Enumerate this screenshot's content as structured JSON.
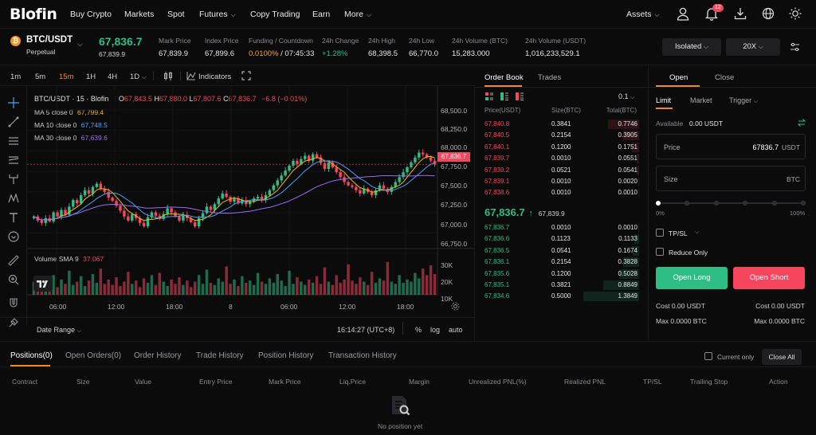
{
  "brand": {
    "logo": "Blofin"
  },
  "nav": {
    "items": [
      "Buy Crypto",
      "Markets",
      "Spot",
      "Futures",
      "Copy Trading",
      "Earn",
      "More"
    ],
    "assets": "Assets",
    "notification_count": "12"
  },
  "ticker": {
    "symbol": "BTC/USDT",
    "type": "Perpetual",
    "price": "67,836.7",
    "price_sub": "67,839.9",
    "stats": [
      {
        "label": "Mark Price",
        "value": "67,839.9"
      },
      {
        "label": "Index Price",
        "value": "67,899.6"
      },
      {
        "label": "Funding / Countdown",
        "value_a": "0.0100%",
        "value_b": " / 07:45:33"
      },
      {
        "label": "24h Change",
        "value": "+1.28%"
      },
      {
        "label": "24h High",
        "value": "68,398.5"
      },
      {
        "label": "24h Low",
        "value": "66,770.0"
      },
      {
        "label": "24h Volume (BTC)",
        "value": "15,283.000"
      },
      {
        "label": "24h Volume (USDT)",
        "value": "1,016,233,529.1"
      }
    ],
    "margin_mode": "Isolated",
    "leverage": "20X"
  },
  "toolbar": {
    "timeframes": [
      "1m",
      "5m",
      "15m",
      "1H",
      "4H",
      "1D"
    ],
    "active_tf": "15m",
    "indicators": "Indicators"
  },
  "chart": {
    "legend_title": "BTC/USDT · 15 · Blofin",
    "ohlc": {
      "o_label": "O",
      "o": "67,843.5",
      "h_label": "H",
      "h": "67,880.0",
      "l_label": "L",
      "l": "67,807.6",
      "c_label": "C",
      "c": "67,836.7",
      "chg": "−6.8 (−0.01%)"
    },
    "ma": [
      {
        "label": "MA 5 close 0",
        "value": "67,799.4",
        "color": "#f0b90b"
      },
      {
        "label": "MA 10 close 0",
        "value": "67,748.5",
        "color": "#4a9ff5"
      },
      {
        "label": "MA 30 close 0",
        "value": "67,639.6",
        "color": "#9b6cf0"
      }
    ],
    "volume_label": "Volume SMA 9",
    "volume_value": "37.067",
    "price_axis": [
      "68,500.0",
      "68,250.0",
      "68,000.0",
      "67,750.0",
      "67,500.0",
      "67,250.0",
      "67,000.0",
      "66,750.0"
    ],
    "current_price_tag": "67,836.7",
    "volume_axis": [
      "30K",
      "20K",
      "10K"
    ],
    "time_axis": [
      "06:00",
      "12:00",
      "18:00",
      "8",
      "06:00",
      "12:00",
      "18:00"
    ],
    "date_range": "Date Range",
    "clock": "16:14:27 (UTC+8)",
    "pct": "%",
    "log": "log",
    "auto": "auto",
    "up_color": "#2ebd85",
    "down_color": "#f6465d"
  },
  "chart_data": {
    "type": "candlestick",
    "title": "BTC/USDT · 15 · Blofin",
    "ylim": [
      66750,
      68500
    ],
    "ylabel": "USDT",
    "x_ticks": [
      "06:00",
      "12:00",
      "18:00",
      "8",
      "06:00",
      "12:00",
      "18:00"
    ],
    "close": [
      67200,
      67150,
      67120,
      67180,
      67140,
      67250,
      67200,
      67280,
      67220,
      67320,
      67400,
      67360,
      67460,
      67520,
      67480,
      67560,
      67600,
      67540,
      67500,
      67430,
      67390,
      67330,
      67270,
      67200,
      67150,
      67230,
      67180,
      67120,
      67080,
      67190,
      67250,
      67210,
      67170,
      67230,
      67300,
      67250,
      67200,
      67150,
      67220,
      67180,
      67130,
      67080,
      67180,
      67240,
      67320,
      67280,
      67350,
      67420,
      67480,
      67440,
      67380,
      67420,
      67360,
      67400,
      67350,
      67380,
      67420,
      67440,
      67400,
      67460,
      67520,
      67580,
      67640,
      67700,
      67760,
      67820,
      67880,
      67840,
      67900,
      67940,
      67880,
      67960,
      67920,
      67850,
      67780,
      67860,
      67800,
      67740,
      67680,
      67620,
      67580,
      67560,
      67520,
      67480,
      67540,
      67500,
      67460,
      67520,
      67580,
      67540,
      67500,
      67560,
      67620,
      67680,
      67740,
      67800,
      67860,
      67920,
      67980,
      67960,
      67920,
      67880,
      67836.7
    ],
    "volume": [
      12,
      8,
      15,
      9,
      11,
      18,
      7,
      14,
      10,
      22,
      9,
      12,
      17,
      8,
      13,
      19,
      11,
      24,
      10,
      14,
      9,
      16,
      8,
      12,
      21,
      10,
      13,
      7,
      15,
      11,
      18,
      9,
      20,
      12,
      8,
      14,
      10,
      16,
      9,
      13,
      7,
      12,
      18,
      10,
      23,
      11,
      9,
      15,
      12,
      26,
      10,
      14,
      8,
      17,
      11,
      13,
      9,
      20,
      12,
      10,
      15,
      11,
      19,
      13,
      8,
      22,
      10,
      16,
      12,
      9,
      14,
      11,
      17,
      10,
      25,
      12,
      9,
      18,
      11,
      14,
      28,
      13,
      10,
      16,
      12,
      9,
      21,
      11,
      15,
      13,
      30,
      12,
      10,
      18,
      11,
      14,
      12,
      20,
      15,
      24,
      18,
      27,
      19
    ]
  },
  "orderbook": {
    "tab_book": "Order Book",
    "tab_trades": "Trades",
    "precision": "0.1",
    "headers": [
      "Price(USDT)",
      "Size(BTC)",
      "Total(BTC)"
    ],
    "asks": [
      [
        "67,840.8",
        "0.3841",
        "0.7746",
        0.56
      ],
      [
        "67,840.5",
        "0.2154",
        "0.3905",
        0.28
      ],
      [
        "67,840.1",
        "0.1200",
        "0.1751",
        0.13
      ],
      [
        "67,839.7",
        "0.0010",
        "0.0551",
        0.04
      ],
      [
        "67,839.2",
        "0.0521",
        "0.0541",
        0.04
      ],
      [
        "67,839.1",
        "0.0010",
        "0.0020",
        0.02
      ],
      [
        "67,838.6",
        "0.0010",
        "0.0010",
        0.02
      ]
    ],
    "mid_price": "67,836.7",
    "mid_arrow": "↑",
    "mid_mark": "67,839.9",
    "bids": [
      [
        "67,836.7",
        "0.0010",
        "0.0010",
        0.02
      ],
      [
        "67,836.6",
        "0.1123",
        "0.1133",
        0.08
      ],
      [
        "67,836.5",
        "0.0541",
        "0.1674",
        0.12
      ],
      [
        "67,836.1",
        "0.2154",
        "0.3828",
        0.28
      ],
      [
        "67,835.6",
        "0.1200",
        "0.5028",
        0.36
      ],
      [
        "67,835.1",
        "0.3821",
        "0.8849",
        0.64
      ],
      [
        "67,834.6",
        "0.5000",
        "1.3849",
        1.0
      ]
    ]
  },
  "order_form": {
    "tab_open": "Open",
    "tab_close": "Close",
    "types": [
      "Limit",
      "Market",
      "Trigger"
    ],
    "available_label": "Available",
    "available_value": "0.00 USDT",
    "price_label": "Price",
    "price_value": "67836.7",
    "price_unit": "USDT",
    "size_label": "Size",
    "size_unit": "BTC",
    "slider_min": "0%",
    "slider_max": "100%",
    "slider_level": 0,
    "tpsl": "TP/SL",
    "reduce_only": "Reduce Only",
    "open_long": "Open Long",
    "open_short": "Open Short",
    "cost_long": "Cost 0.00 USDT",
    "cost_short": "Cost 0.00 USDT",
    "max_long": "Max 0.0000 BTC",
    "max_short": "Max 0.0000 BTC"
  },
  "positions": {
    "tabs": [
      "Positions(0)",
      "Open Orders(0)",
      "Order History",
      "Trade History",
      "Position History",
      "Transaction History"
    ],
    "current_only": "Current only",
    "close_all": "Close All",
    "columns": [
      "Contract",
      "Size",
      "Value",
      "Entry Price",
      "Mark Price",
      "Liq.Price",
      "Margin",
      "Unrealized PNL(%)",
      "Realized PNL",
      "TP/SL",
      "Trailing Stop",
      "Action"
    ],
    "empty": "No position yet"
  }
}
